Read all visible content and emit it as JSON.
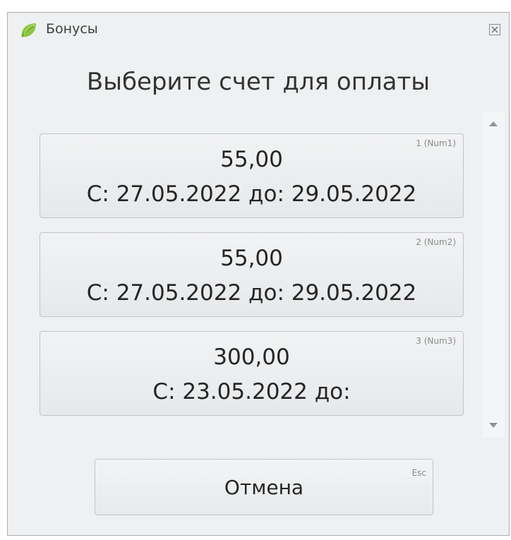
{
  "window": {
    "title": "Бонусы",
    "app_icon": "leaf-icon",
    "close_icon": "close-icon"
  },
  "heading": "Выберите счет для оплаты",
  "accounts": [
    {
      "amount": "55,00",
      "period": "С: 27.05.2022 до: 29.05.2022",
      "hotkey": "1 (Num1)"
    },
    {
      "amount": "55,00",
      "period": "С: 27.05.2022 до: 29.05.2022",
      "hotkey": "2 (Num2)"
    },
    {
      "amount": "300,00",
      "period": "С: 23.05.2022 до:",
      "hotkey": "3 (Num3)"
    }
  ],
  "scrollbar": {
    "up_icon": "triangle-up-icon",
    "down_icon": "triangle-down-icon"
  },
  "cancel": {
    "label": "Отмена",
    "hotkey": "Esc"
  },
  "colors": {
    "window_bg": "#eef0f1",
    "button_border": "#c2c5c8",
    "leaf_green": "#8cc63f"
  }
}
